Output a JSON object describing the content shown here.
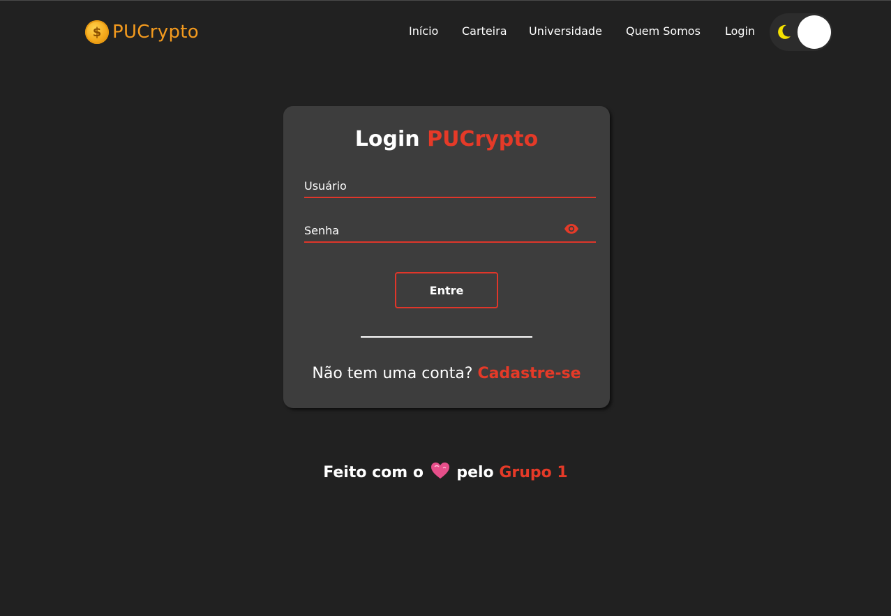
{
  "brand": {
    "name": "PUCrypto",
    "coin_symbol": "$"
  },
  "nav": {
    "items": [
      {
        "label": "Início"
      },
      {
        "label": "Carteira"
      },
      {
        "label": "Universidade"
      },
      {
        "label": "Quem Somos"
      },
      {
        "label": "Login"
      }
    ],
    "theme_toggle": {
      "icon": "moon-icon",
      "state": "dark"
    }
  },
  "login_card": {
    "title_prefix": "Login",
    "title_brand": "PUCrypto",
    "username_placeholder": "Usuário",
    "password_placeholder": "Senha",
    "submit_label": "Entre",
    "signup_prompt": "Não tem uma conta?",
    "signup_link": "Cadastre-se"
  },
  "footer": {
    "text_before": "Feito com o",
    "heart_icon": "heart-icon",
    "text_middle": "pelo",
    "team": "Grupo 1"
  },
  "colors": {
    "background": "#212121",
    "card": "#3d3d3d",
    "accent": "#e53a28",
    "logo_orange": "#f39a1e",
    "moon_yellow": "#f5e200"
  }
}
